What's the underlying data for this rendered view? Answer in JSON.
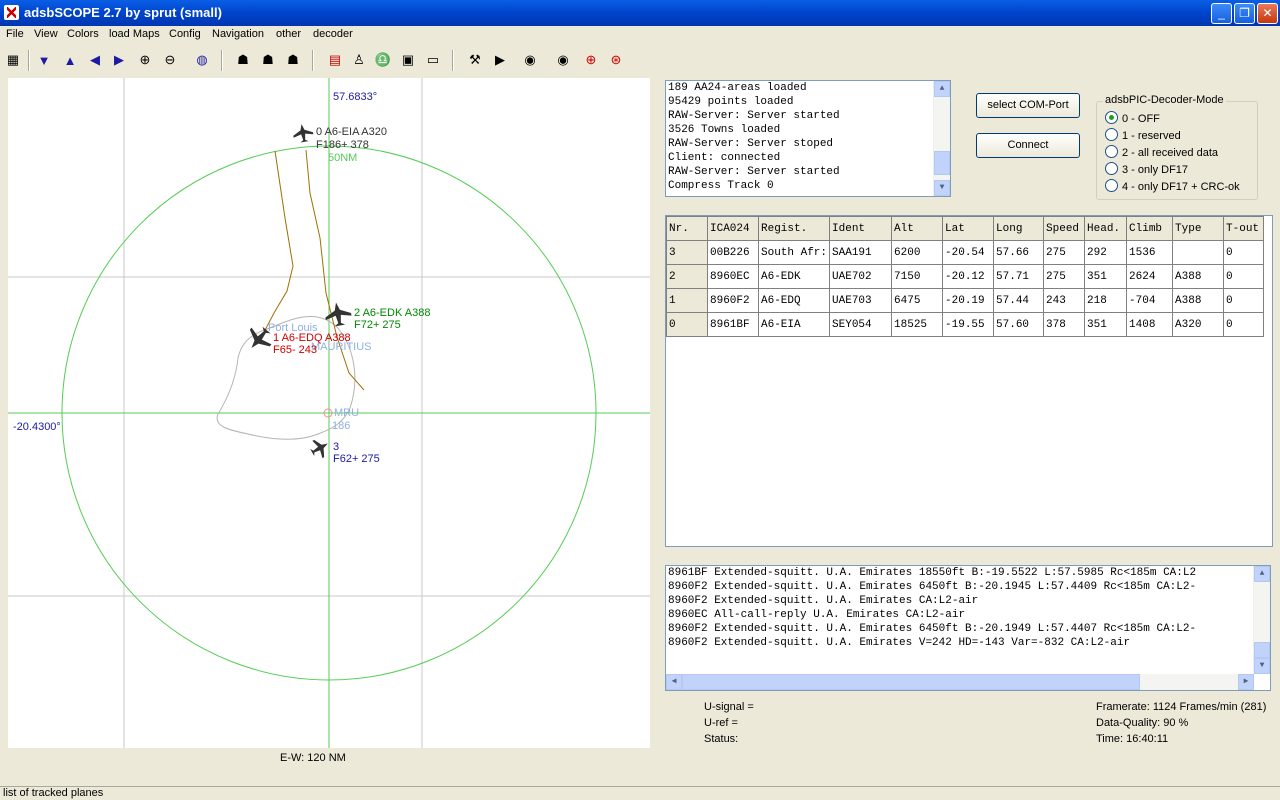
{
  "window": {
    "title": "adsbSCOPE 2.7 by sprut  (small)"
  },
  "menu": [
    "File",
    "View",
    "Colors",
    "load Maps",
    "Config",
    "Navigation",
    "other",
    "decoder"
  ],
  "icons": {
    "colors": {
      "planes": "#333333",
      "range_ring": "#55cc55",
      "grid": "#c8c8c8",
      "track": "#a07000",
      "label_blue": "#1a1aa6",
      "label_green": "#00aa00",
      "label_red": "#cc0000"
    }
  },
  "map": {
    "lat_top": "57.6833°",
    "lon_left": "-20.4300°",
    "ring_label": "50NM",
    "port_louis": "Port Louis",
    "mauritius": "MAURITIUS",
    "airport_code": "MRU",
    "airport_value": "186",
    "ew_label": "E-W: 120 NM",
    "aircraft": [
      {
        "label1": "0  A6-EIA  A320",
        "label2": "F186+  378"
      },
      {
        "label1": "2  A6-EDK  A388",
        "label2": "F72+  275"
      },
      {
        "label1": "1  A6-EDQ  A388",
        "label2": "F65-  243"
      },
      {
        "label1": "3",
        "label2": "F62+  275"
      }
    ]
  },
  "log": [
    "189 AA24-areas loaded",
    "95429 points loaded",
    "RAW-Server: Server started",
    "3526 Towns loaded",
    "RAW-Server: Server stoped",
    "Client: connected",
    "RAW-Server: Server started",
    "Compress Track 0"
  ],
  "buttons": {
    "com_port": "select COM-Port",
    "connect": "Connect"
  },
  "decoder_mode": {
    "legend": "adsbPIC-Decoder-Mode",
    "options": [
      "0 - OFF",
      "1 - reserved",
      "2 - all received data",
      "3 - only DF17",
      "4 - only DF17 + CRC-ok"
    ],
    "selected": 0
  },
  "table": {
    "headers": [
      "Nr.",
      "ICA024",
      "Regist.",
      "Ident",
      "Alt",
      "Lat",
      "Long",
      "Speed",
      "Head.",
      "Climb",
      "Type",
      "T-out"
    ],
    "rows": [
      [
        "3",
        "00B226",
        "South Afr:",
        "SAA191",
        "6200",
        "-20.54",
        "57.66",
        "275",
        "292",
        "1536",
        "",
        "0"
      ],
      [
        "2",
        "8960EC",
        "A6-EDK",
        "UAE702",
        "7150",
        "-20.12",
        "57.71",
        "275",
        "351",
        "2624",
        "A388",
        "0"
      ],
      [
        "1",
        "8960F2",
        "A6-EDQ",
        "UAE703",
        "6475",
        "-20.19",
        "57.44",
        "243",
        "218",
        "-704",
        "A388",
        "0"
      ],
      [
        "0",
        "8961BF",
        "A6-EIA",
        "SEY054",
        "18525",
        "-19.55",
        "57.60",
        "378",
        "351",
        "1408",
        "A320",
        "0"
      ]
    ]
  },
  "messages": [
    "8961BF Extended-squitt. U.A. Emirates  18550ft  B:-19.5522  L:57.5985 Rc<185m  CA:L2",
    "8960F2 Extended-squitt. U.A. Emirates  6450ft  B:-20.1945  L:57.4409 Rc<185m  CA:L2-",
    "8960F2 Extended-squitt. U.A. Emirates  CA:L2-air",
    "8960EC All-call-reply   U.A. Emirates  CA:L2-air",
    "8960F2 Extended-squitt. U.A. Emirates  6450ft  B:-20.1949  L:57.4407 Rc<185m  CA:L2-",
    "8960F2 Extended-squitt. U.A. Emirates  V=242 HD=-143 Var=-832  CA:L2-air"
  ],
  "signal": {
    "u_signal": "U-signal =",
    "u_ref": "U-ref =",
    "status": "Status:"
  },
  "stats": {
    "framerate": "Framerate:  1124 Frames/min (281)",
    "quality": "Data-Quality: 90 %",
    "time": "Time: 16:40:11"
  },
  "statusbar": "list of tracked planes"
}
